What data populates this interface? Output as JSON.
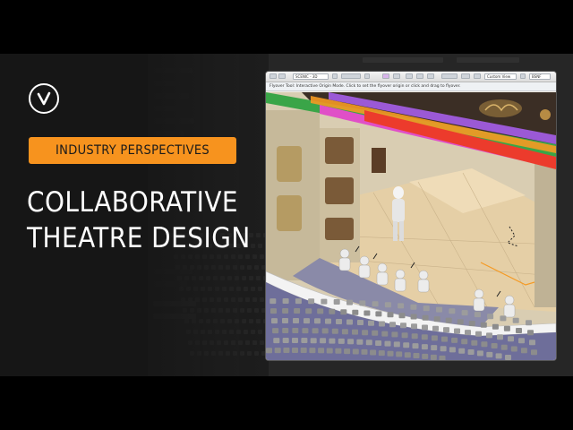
{
  "overlay": {
    "tag_label": "INDUSTRY PERSPECTIVES",
    "title_line1": "COLLABORATIVE",
    "title_line2": "THEATRE DESIGN",
    "logo_icon": "vectorworks-v-icon",
    "tag_color": "#f7931e"
  },
  "app_window": {
    "toolbar": {
      "layer_select": "SCENIC - 3D",
      "view_select": "Custom View",
      "render_select": "BSNF"
    },
    "info_bar": "Flyover Tool: Interactive Origin Mode. Click to set the flyover origin or click and drag to flyover."
  },
  "colors": {
    "background": "#1b1b1b",
    "accent_orange": "#f7931e",
    "batten_green": "#3aa548",
    "batten_purple": "#9b59d6",
    "batten_magenta": "#e04fc7",
    "batten_orange": "#f59a23",
    "batten_red": "#ec3b2c",
    "stage_floor": "#e5cfa6",
    "house_floor": "#6e6e9a"
  }
}
